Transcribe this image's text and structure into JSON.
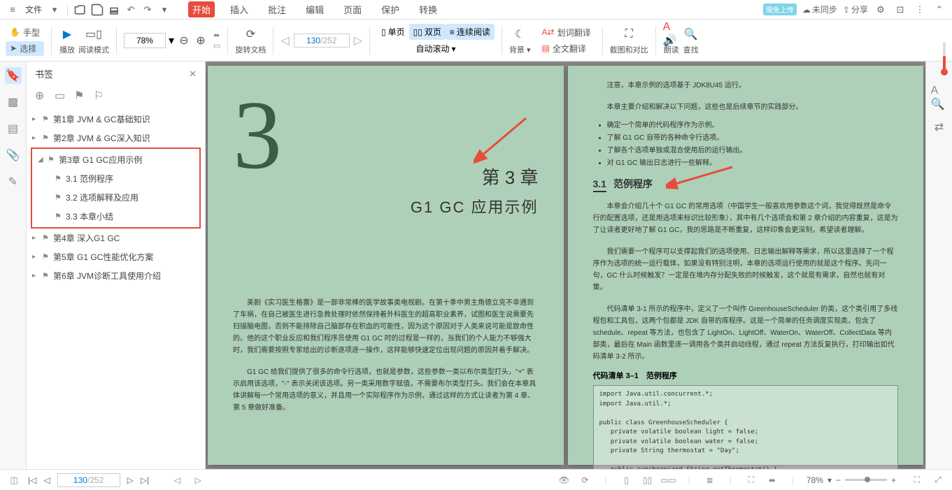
{
  "menu": {
    "file": "文件",
    "tabs": [
      "开始",
      "插入",
      "批注",
      "编辑",
      "页面",
      "保护",
      "转换"
    ],
    "activeTab": 0,
    "right": {
      "sync": "未同步",
      "share": "分享",
      "badge": "限免上传"
    }
  },
  "toolbar": {
    "hand": "手型",
    "select": "选择",
    "play": "播放",
    "readMode": "阅读模式",
    "zoom": "78%",
    "rotate": "旋转文档",
    "pageCurrent": "130",
    "pageTotal": "/252",
    "single": "单页",
    "double": "双页",
    "continuous": "连续阅读",
    "autoScroll": "自动滚动",
    "background": "背景",
    "wordTrans": "划词翻译",
    "fullTrans": "全文翻译",
    "screenshot": "截图和对比",
    "read": "朗读",
    "find": "查找"
  },
  "panel": {
    "title": "书签",
    "bookmarks": [
      {
        "label": "第1章 JVM & GC基础知识",
        "children": []
      },
      {
        "label": "第2章 JVM & GC深入知识",
        "children": []
      },
      {
        "label": "第3章 G1 GC应用示例",
        "expanded": true,
        "highlight": true,
        "children": [
          {
            "label": "3.1 范例程序"
          },
          {
            "label": "3.2 选项解释及应用"
          },
          {
            "label": "3.3 本章小结"
          }
        ]
      },
      {
        "label": "第4章 深入G1 GC",
        "children": []
      },
      {
        "label": "第5章 G1 GC性能优化方案",
        "children": []
      },
      {
        "label": "第6章 JVM诊断工具使用介绍",
        "children": []
      }
    ]
  },
  "leftPage": {
    "bigNum": "3",
    "chapterLabel": "第 3 章",
    "chapterTitle": "G1 GC 应用示例",
    "para1": "美剧《实习医生格蕾》是一部非常棒的医学故事类电视剧。在第十季中男主角德立克不幸遇到了车祸，在自己被医生进行急救处理时依然保持着外科医生的超高职业素养，试图和医生说需要先扫描脑电图，否则不能排除自己脑部存在积血的可能性，因为这个原因对于人类来说可能是致命性的。他的这个职业反应和我们程序员使用 G1 GC 时的过程是一样的，当我们的个人能力不够强大时，我们需要按照专家给出的诊断逐项逐一操作，这样能够快速定位出现问题的原因并着手解决。",
    "para2": "G1 GC 给我们提供了很多的命令行选项，也就是参数，这些参数一类以布尔类型打头，\"+\" 表示启用该选项，\"-\" 表示关闭该选项。另一类采用数字赋值，不需要布尔类型打头。我们会在本章具体讲解每一个常用选项的意义，并且用一个实际程序作为示例，通过这样的方式让读者为第 4 章、第 5 章做好准备。"
  },
  "rightPage": {
    "note": "注意，本章示例的选项基于 JDK8U45 运行。",
    "intro": "本章主要介绍和解决以下问题，这些也是后续章节的实践部分。",
    "bullets": [
      "确定一个简单的代码程序作为示例。",
      "了解 G1 GC 自带的各种命令行选项。",
      "了解各个选项单独或混合使用后的运行输出。",
      "对 G1 GC 输出日志进行一些解释。"
    ],
    "sectionNum": "3.1",
    "sectionTitle": "范例程序",
    "p1": "本章会介绍几十个 G1 GC 的常用选项（中国学生一般喜欢用参数这个词，我觉得既然是命令行的配置选项，还是用选项来标识比较形象），其中有几个选项会和第 2 章介绍的内容重复，这是为了让读者更好地了解 G1 GC，我的思路是不断重复，这样印象会更深刻，希望读者理解。",
    "p2": "我们需要一个程序可以支撑起我们的选项使用、日志输出解释等需求，所以这里选择了一个程序作为选项的统一运行载体，如果没有特别注明，本章的选项运行使用的就是这个程序。先问一句，GC 什么时候触发？一定是在堆内存分配失败的时候触发，这个就是有需求，自然也就有对策。",
    "p3": "代码清单 3-1 所示的程序中，定义了一个叫作 GreenhouseScheduler 的类，这个类引用了多线程包和工具包，这两个包都是 JDK 自带的库程序。这是一个简单的任务调度实现类，包含了 schedule、repeat 等方法，也包含了 LightOn、LightOff、WaterOn、WaterOff、CollectData 等内部类，最后在 Main 函数里逐一调用各个类并启动线程，通过 repeat 方法反复执行，打印输出如代码清单 3-2 所示。",
    "codeTitle": "代码清单 3–1　范例程序",
    "code": "import Java.util.concurrent.*;\nimport Java.util.*;\n\npublic class GreenhouseScheduler {\n   private volatile boolean light = false;\n   private volatile boolean water = false;\n   private String thermostat = \"Day\";\n\n   public synchronized String getThermostat() {"
  },
  "status": {
    "pageCurrent": "130",
    "pageTotal": "/252",
    "zoom": "78%"
  }
}
